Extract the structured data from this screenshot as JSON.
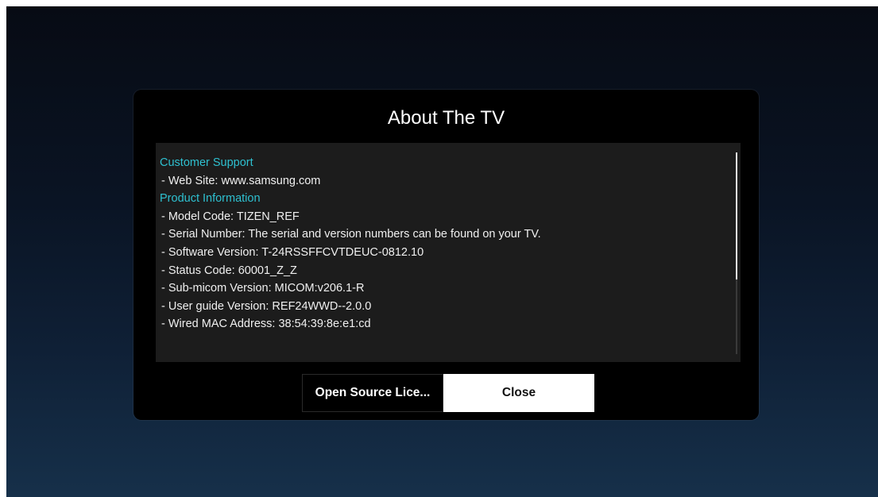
{
  "dialog": {
    "title": "About The TV",
    "customer_support": {
      "heading": "Customer Support",
      "web_site": "- Web Site: www.samsung.com"
    },
    "product_information": {
      "heading": "Product Information",
      "model_code": "- Model Code: TIZEN_REF",
      "serial_number": "- Serial Number: The serial and version numbers can be found on your TV.",
      "software_version": "- Software Version: T-24RSSFFCVTDEUC-0812.10",
      "status_code": "- Status Code:  60001_Z_Z",
      "sub_micom_version": "- Sub-micom Version: MICOM:v206.1-R",
      "user_guide_version": "- User guide Version: REF24WWD--2.0.0",
      "wired_mac_address": "- Wired MAC Address: 38:54:39:8e:e1:cd"
    },
    "buttons": {
      "open_source": "Open Source Lice...",
      "close": "Close"
    },
    "colors": {
      "section_heading": "#2ec0d0",
      "panel_background": "#1c1c1c",
      "dialog_background": "#000000"
    }
  }
}
